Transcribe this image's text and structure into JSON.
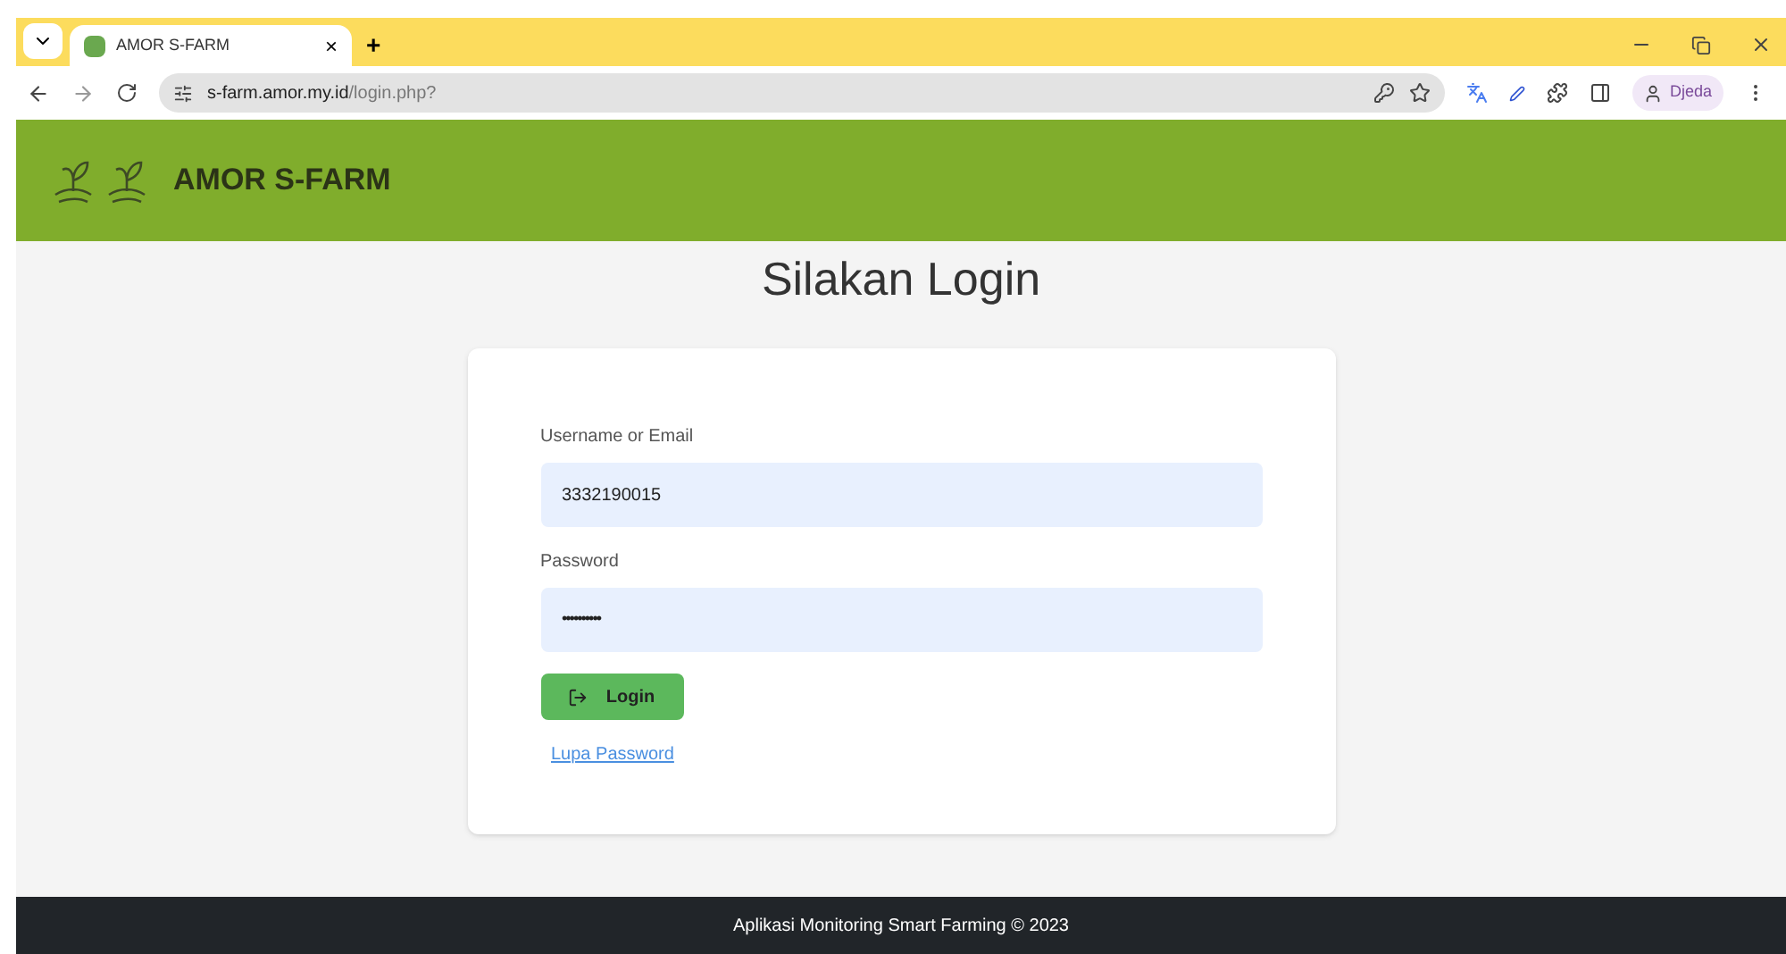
{
  "browser": {
    "tab": {
      "title": "AMOR S-FARM",
      "close": "×"
    },
    "new_tab": "+",
    "url": {
      "host": "s-farm.amor.my.id",
      "path": "/login.php?"
    },
    "profile": "Djeda"
  },
  "header": {
    "brand": "AMOR S-FARM"
  },
  "page": {
    "title": "Silakan Login"
  },
  "form": {
    "fields": [
      {
        "label": "Username or Email",
        "value": "3332190015",
        "kind": "text"
      },
      {
        "label": "Password",
        "value": "••••••••••",
        "kind": "password"
      }
    ],
    "submit": "Login",
    "forgot": "Lupa Password"
  },
  "footer": "Aplikasi Monitoring Smart Farming © 2023"
}
